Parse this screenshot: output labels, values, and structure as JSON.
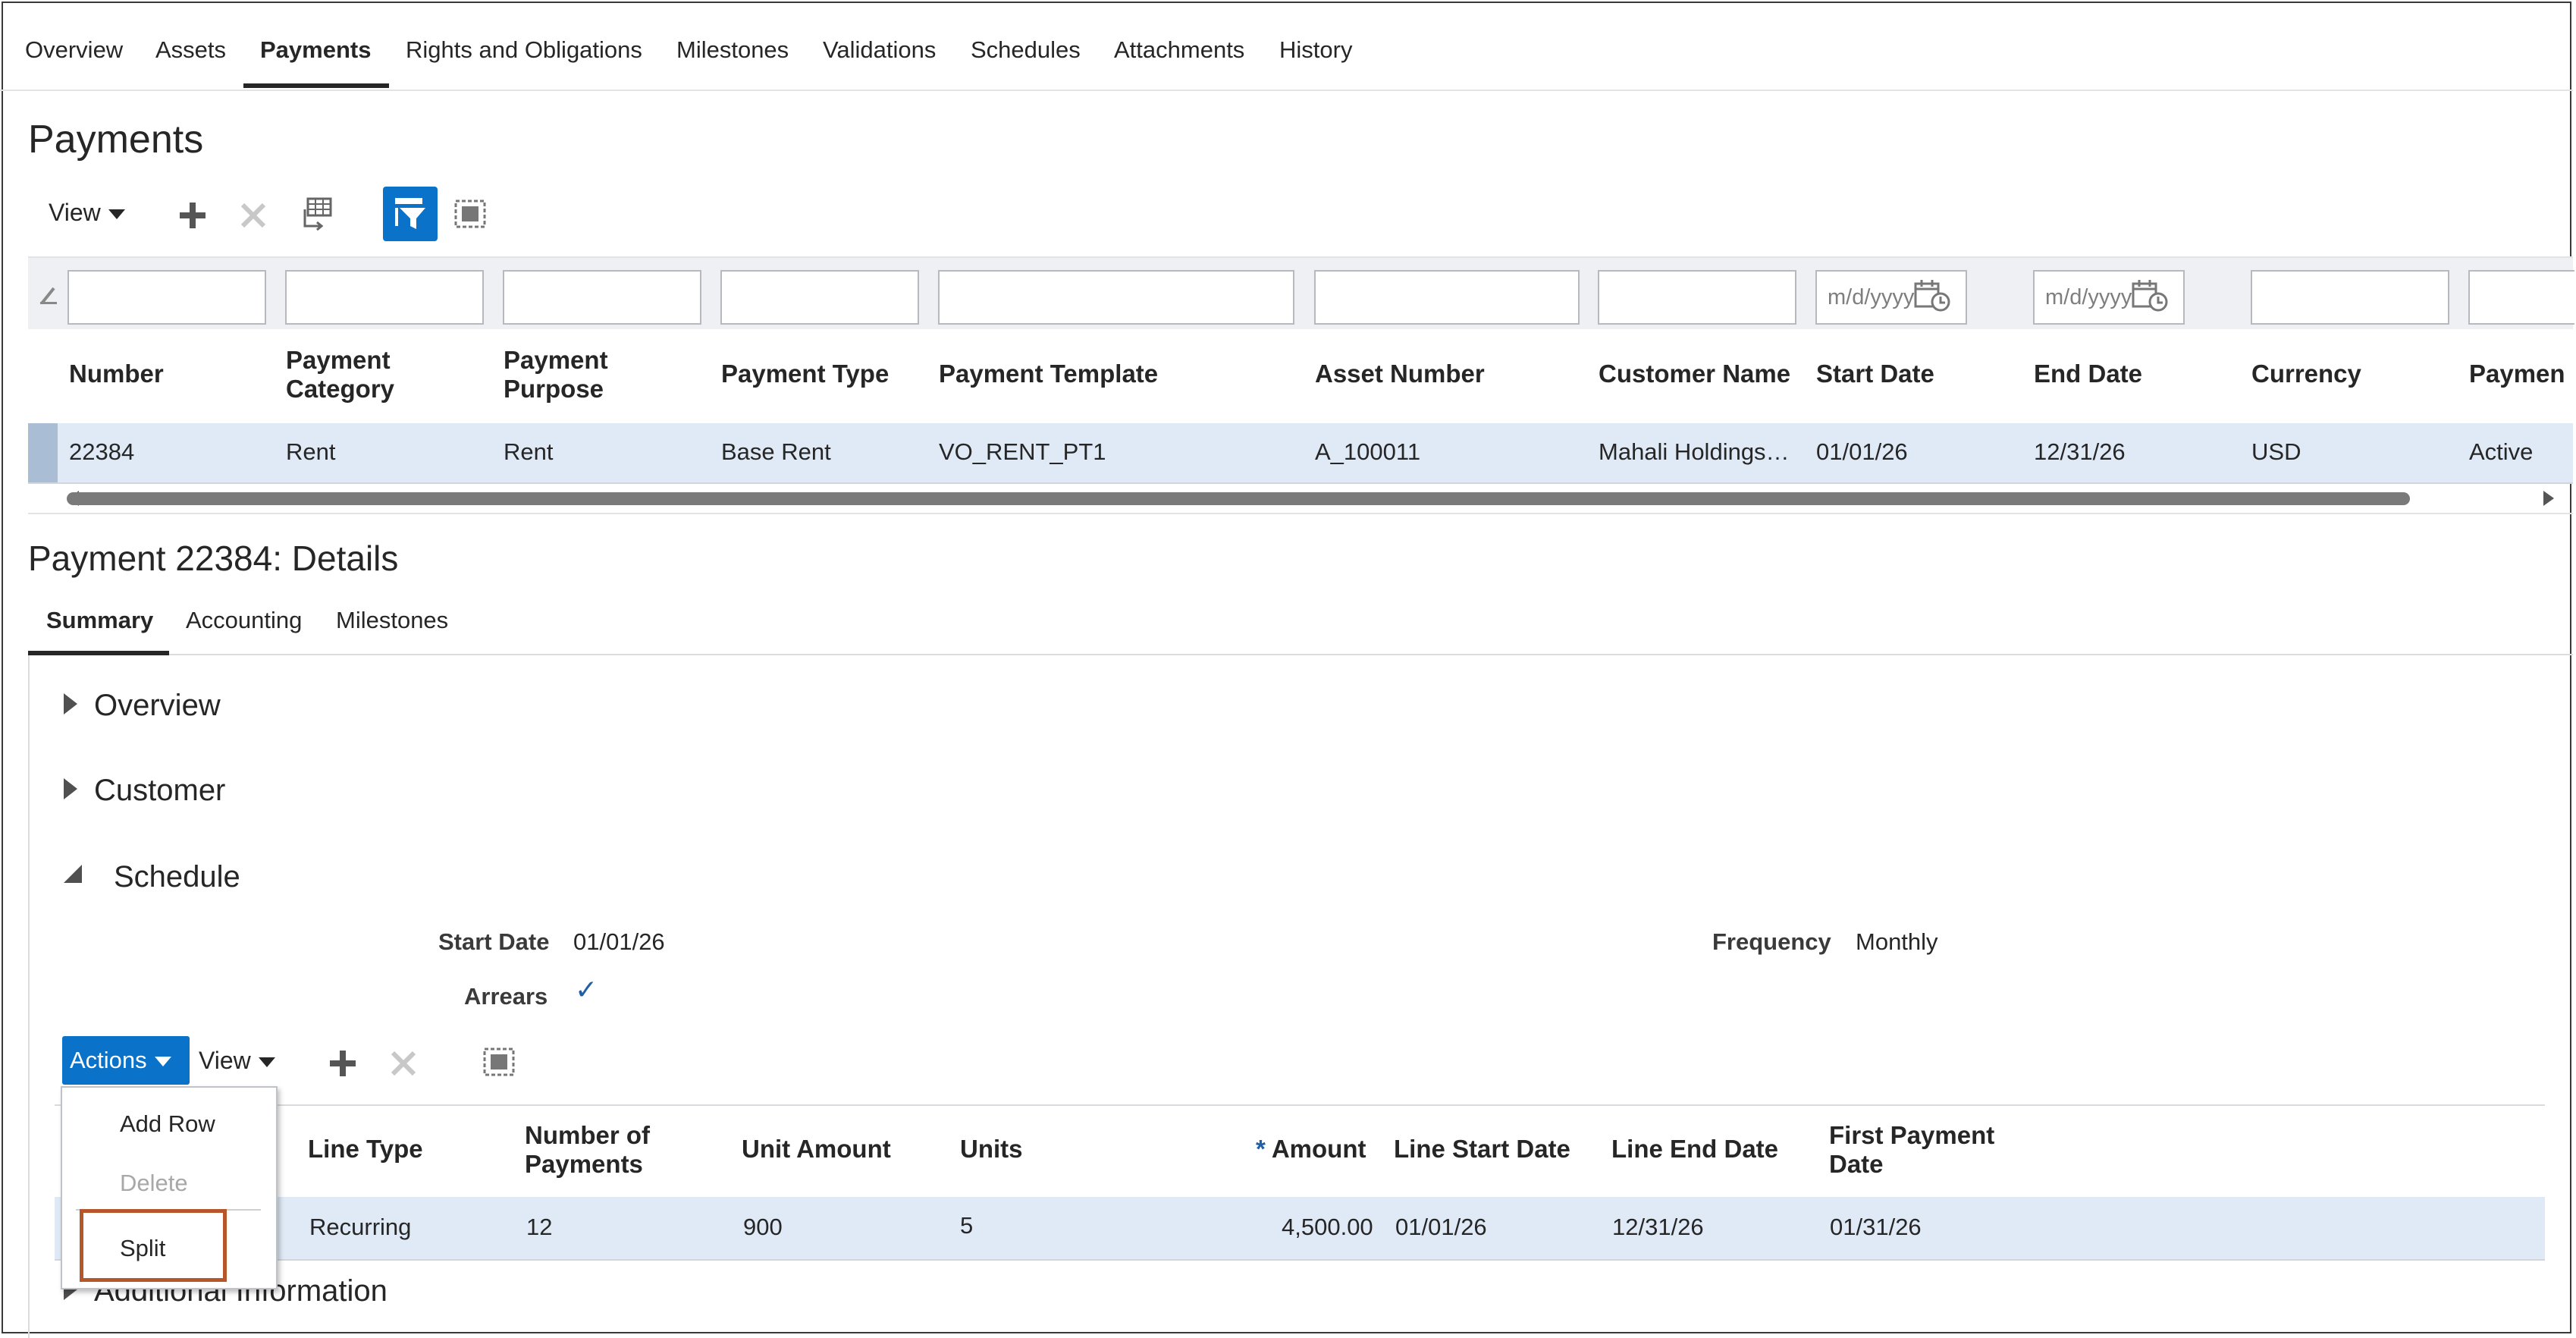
{
  "top_tabs": [
    "Overview",
    "Assets",
    "Payments",
    "Rights and Obligations",
    "Milestones",
    "Validations",
    "Schedules",
    "Attachments",
    "History"
  ],
  "page_title": "Payments",
  "toolbar": {
    "view_label": "View"
  },
  "filter_placeholders": {
    "date": "m/d/yyyy"
  },
  "payments_table": {
    "headers": [
      "Number",
      "Payment Category",
      "Payment Purpose",
      "Payment Type",
      "Payment Template",
      "Asset Number",
      "Customer Name",
      "Start Date",
      "End Date",
      "Currency",
      "Paymen"
    ],
    "headers_multi": {
      "category_1": "Payment",
      "category_2": "Category",
      "purpose_1": "Payment",
      "purpose_2": "Purpose"
    },
    "row": [
      "22384",
      "Rent",
      "Rent",
      "Base Rent",
      "VO_RENT_PT1",
      "A_100011",
      "Mahali Holdings…",
      "01/01/26",
      "12/31/26",
      "USD",
      "Active"
    ]
  },
  "details_title": "Payment 22384: Details",
  "detail_tabs": [
    "Summary",
    "Accounting",
    "Milestones"
  ],
  "sections": {
    "overview": "Overview",
    "customer": "Customer",
    "schedule": "Schedule",
    "additional": "Additional Information"
  },
  "schedule": {
    "start_date_label": "Start Date",
    "start_date_value": "01/01/26",
    "arrears_label": "Arrears",
    "arrears_check": "✓",
    "frequency_label": "Frequency",
    "frequency_value": "Monthly"
  },
  "schedule_toolbar": {
    "actions_label": "Actions",
    "view_label": "View"
  },
  "actions_menu": {
    "add_row": "Add Row",
    "delete": "Delete",
    "split": "Split"
  },
  "lines_table": {
    "line_type": "Line Type",
    "num_payments_1": "Number of",
    "num_payments_2": "Payments",
    "unit_amount": "Unit Amount",
    "units": "Units",
    "amount_required": "*",
    "amount": "Amount",
    "line_start": "Line Start Date",
    "line_end": "Line End Date",
    "first_payment_1": "First Payment",
    "first_payment_2": "Date",
    "row": {
      "line_type": "Recurring",
      "num_payments": "12",
      "unit_amount": "900",
      "units": "5",
      "amount": "4,500.00",
      "line_start": "01/01/26",
      "line_end": "12/31/26",
      "first_payment": "01/31/26"
    }
  },
  "colors": {
    "accent": "#0a72c9",
    "selected_row": "#dfeaf6",
    "highlight_box": "#b5572b"
  }
}
